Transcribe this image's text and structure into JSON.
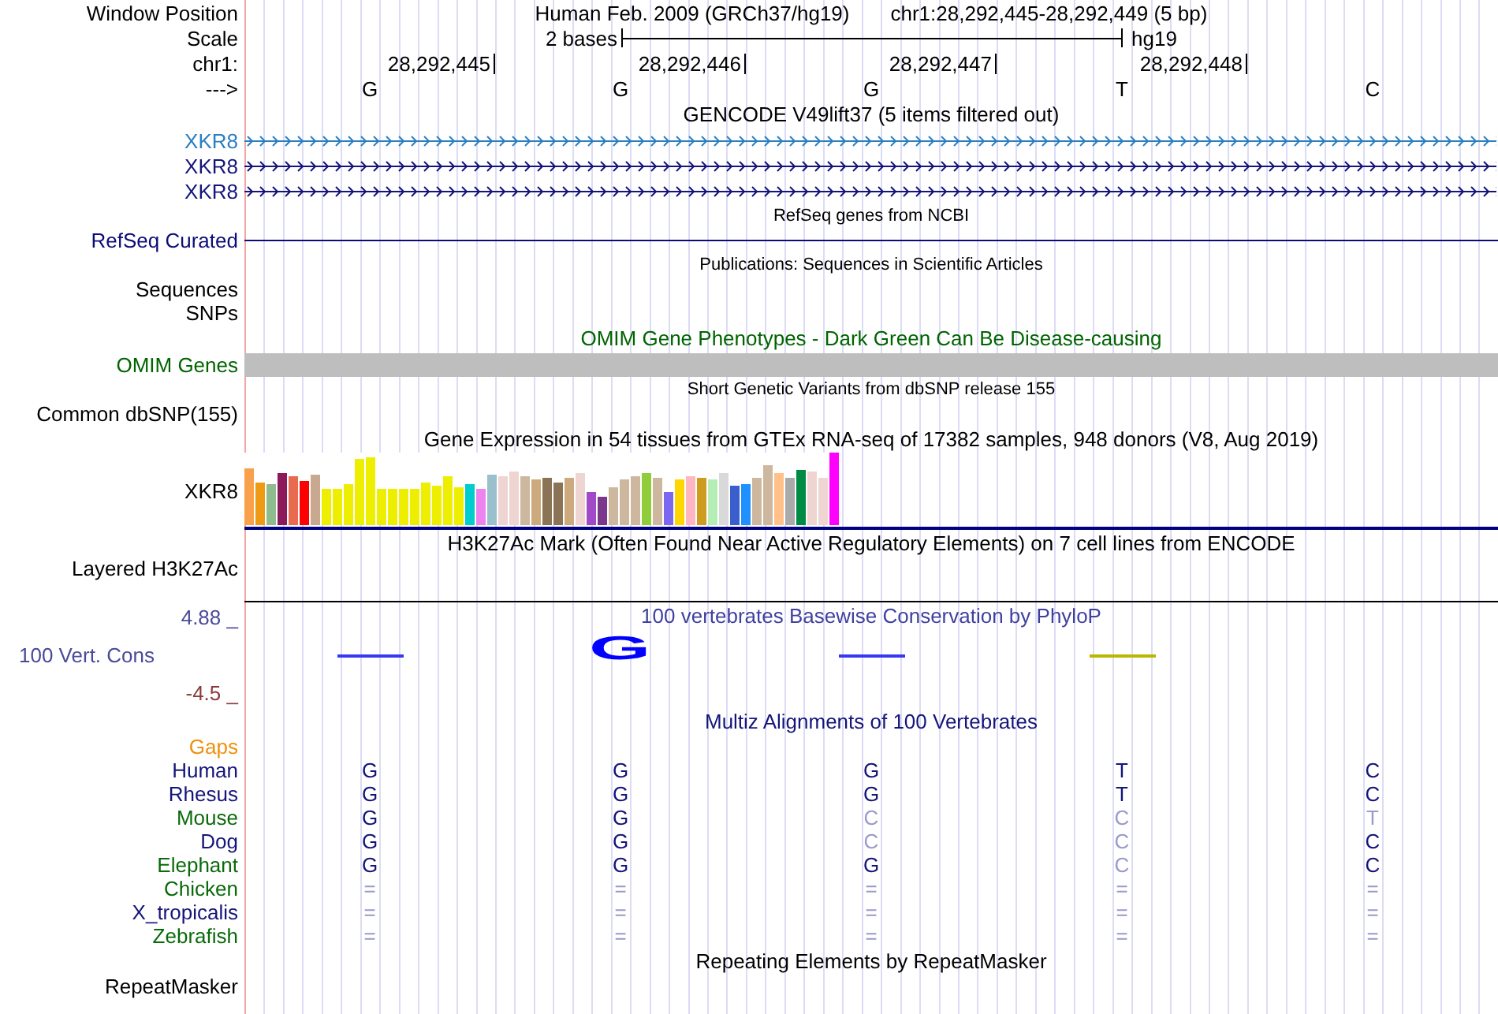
{
  "header": {
    "window_position_label": "Window Position",
    "assembly": "Human Feb. 2009 (GRCh37/hg19)",
    "position": "chr1:28,292,445-28,292,449 (5 bp)",
    "scale_label": "Scale",
    "scale_text": "2 bases",
    "scale_db": "hg19",
    "chrom_label": "chr1:",
    "positions": [
      "28,292,445",
      "28,292,446",
      "28,292,447",
      "28,292,448"
    ],
    "strand_label": "--->",
    "bases": [
      "G",
      "G",
      "G",
      "T",
      "C"
    ]
  },
  "tracks": [
    {
      "kind": "title",
      "text": "GENCODE V49lift37 (5 items filtered out)"
    },
    {
      "kind": "gene",
      "label": "XKR8",
      "color": "#2a7fc0"
    },
    {
      "kind": "gene",
      "label": "XKR8",
      "color": "#14147a"
    },
    {
      "kind": "gene",
      "label": "XKR8",
      "color": "#14147a"
    },
    {
      "kind": "note",
      "text": "RefSeq genes from NCBI"
    },
    {
      "kind": "line",
      "label": "RefSeq Curated",
      "color": "#0c0c78"
    },
    {
      "kind": "note",
      "text": "Publications: Sequences in Scientific Articles"
    },
    {
      "kind": "label",
      "label": "Sequences"
    },
    {
      "kind": "label",
      "label": "SNPs"
    },
    {
      "kind": "title",
      "text": "OMIM Gene Phenotypes - Dark Green Can Be Disease-causing",
      "color": "#006400"
    },
    {
      "kind": "bar",
      "label": "OMIM Genes",
      "color": "#006400"
    },
    {
      "kind": "note",
      "text": "Short Genetic Variants from dbSNP release 155"
    },
    {
      "kind": "label",
      "label": "Common dbSNP(155)"
    },
    {
      "kind": "title",
      "text": "Gene Expression in 54 tissues from GTEx RNA-seq of 17382 samples, 948 donors (V8, Aug 2019)"
    },
    {
      "kind": "expression",
      "label": "XKR8",
      "tissues": [
        {
          "color": "#f8a04b"
        },
        {
          "color": "#ee9a13"
        },
        {
          "color": "#8fbc8f"
        },
        {
          "color": "#8b1a5a"
        },
        {
          "color": "#e86a4f"
        },
        {
          "color": "#ff0000"
        },
        {
          "color": "#c8a990"
        },
        {
          "color": "#eeee00"
        },
        {
          "color": "#eeee00"
        },
        {
          "color": "#eeee00"
        },
        {
          "color": "#eeee00"
        },
        {
          "color": "#eeee00"
        },
        {
          "color": "#eeee00"
        },
        {
          "color": "#eeee00"
        },
        {
          "color": "#eeee00"
        },
        {
          "color": "#eeee00"
        },
        {
          "color": "#eeee00"
        },
        {
          "color": "#eeee00"
        },
        {
          "color": "#eeee00"
        },
        {
          "color": "#eeee00"
        },
        {
          "color": "#00cdcd"
        },
        {
          "color": "#ee82ee"
        },
        {
          "color": "#9ac0cd"
        },
        {
          "color": "#eed5d2"
        },
        {
          "color": "#eed5d2"
        },
        {
          "color": "#cdb79e"
        },
        {
          "color": "#cdaa7d"
        },
        {
          "color": "#8b7355"
        },
        {
          "color": "#8b7355"
        },
        {
          "color": "#cdaa7d"
        },
        {
          "color": "#eed5d2"
        },
        {
          "color": "#a04ac8"
        },
        {
          "color": "#7a378b"
        },
        {
          "color": "#cdb79e"
        },
        {
          "color": "#cdb79e"
        },
        {
          "color": "#cdb79e"
        },
        {
          "color": "#8fce3a"
        },
        {
          "color": "#cdb79e"
        },
        {
          "color": "#7b68ee"
        },
        {
          "color": "#ffd700"
        },
        {
          "color": "#ffb6c1"
        },
        {
          "color": "#cd9b1d"
        },
        {
          "color": "#b4eeb4"
        },
        {
          "color": "#d9d9d9"
        },
        {
          "color": "#3a5fcd"
        },
        {
          "color": "#1e90ff"
        },
        {
          "color": "#cdb79e"
        },
        {
          "color": "#cdb79e"
        },
        {
          "color": "#ffc08a"
        },
        {
          "color": "#aaaaaa"
        },
        {
          "color": "#008b45"
        },
        {
          "color": "#eed5d2"
        },
        {
          "color": "#eed5d2"
        },
        {
          "color": "#ff00ff"
        }
      ]
    },
    {
      "kind": "title",
      "text": "H3K27Ac Mark (Often Found Near Active Regulatory Elements) on 7 cell lines from ENCODE"
    },
    {
      "kind": "layered",
      "label": "Layered H3K27Ac"
    },
    {
      "kind": "conservation",
      "label": "100 Vert. Cons",
      "max": "4.88 _",
      "min": "-4.5 _",
      "title": "100 vertebrates Basewise Conservation by PhyloP",
      "columns": [
        {
          "kind": "dash",
          "color": "#3838f0"
        },
        {
          "kind": "letter",
          "letter": "G",
          "color": "#0000ff"
        },
        {
          "kind": "dash",
          "color": "#3838f0"
        },
        {
          "kind": "dash",
          "color": "#b8b800"
        },
        {
          "kind": "empty"
        }
      ]
    },
    {
      "kind": "title",
      "text": "Multiz Alignments of 100 Vertebrates",
      "color": "#14147a"
    },
    {
      "kind": "label",
      "label": "Gaps",
      "color": "#f0900c"
    },
    {
      "kind": "alignment",
      "label": "Human",
      "color": "#14147a",
      "bases": [
        {
          "base": "G",
          "match": true
        },
        {
          "base": "G",
          "match": true
        },
        {
          "base": "G",
          "match": true
        },
        {
          "base": "T",
          "match": true
        },
        {
          "base": "C",
          "match": true
        }
      ]
    },
    {
      "kind": "alignment",
      "label": "Rhesus",
      "color": "#14147a",
      "bases": [
        {
          "base": "G",
          "match": true
        },
        {
          "base": "G",
          "match": true
        },
        {
          "base": "G",
          "match": true
        },
        {
          "base": "T",
          "match": true
        },
        {
          "base": "C",
          "match": true
        }
      ]
    },
    {
      "kind": "alignment",
      "label": "Mouse",
      "color": "#0a6a0a",
      "bases": [
        {
          "base": "G",
          "match": true
        },
        {
          "base": "G",
          "match": true
        },
        {
          "base": "C",
          "match": false
        },
        {
          "base": "C",
          "match": false
        },
        {
          "base": "T",
          "match": false
        }
      ]
    },
    {
      "kind": "alignment",
      "label": "Dog",
      "color": "#14147a",
      "bases": [
        {
          "base": "G",
          "match": true
        },
        {
          "base": "G",
          "match": true
        },
        {
          "base": "C",
          "match": false
        },
        {
          "base": "C",
          "match": false
        },
        {
          "base": "C",
          "match": true
        }
      ]
    },
    {
      "kind": "alignment",
      "label": "Elephant",
      "color": "#0a6a0a",
      "bases": [
        {
          "base": "G",
          "match": true
        },
        {
          "base": "G",
          "match": true
        },
        {
          "base": "G",
          "match": true
        },
        {
          "base": "C",
          "match": false
        },
        {
          "base": "C",
          "match": true
        }
      ]
    },
    {
      "kind": "alignment",
      "label": "Chicken",
      "color": "#0a6a0a",
      "bases": [
        {
          "base": "=",
          "match": false
        },
        {
          "base": "=",
          "match": false
        },
        {
          "base": "=",
          "match": false
        },
        {
          "base": "=",
          "match": false
        },
        {
          "base": "=",
          "match": false
        }
      ]
    },
    {
      "kind": "alignment",
      "label": "X_tropicalis",
      "color": "#14147a",
      "bases": [
        {
          "base": "=",
          "match": false
        },
        {
          "base": "=",
          "match": false
        },
        {
          "base": "=",
          "match": false
        },
        {
          "base": "=",
          "match": false
        },
        {
          "base": "=",
          "match": false
        }
      ]
    },
    {
      "kind": "alignment",
      "label": "Zebrafish",
      "color": "#0a6a0a",
      "bases": [
        {
          "base": "=",
          "match": false
        },
        {
          "base": "=",
          "match": false
        },
        {
          "base": "=",
          "match": false
        },
        {
          "base": "=",
          "match": false
        },
        {
          "base": "=",
          "match": false
        }
      ]
    },
    {
      "kind": "title",
      "text": "Repeating Elements by RepeatMasker"
    },
    {
      "kind": "label",
      "label": "RepeatMasker"
    }
  ]
}
